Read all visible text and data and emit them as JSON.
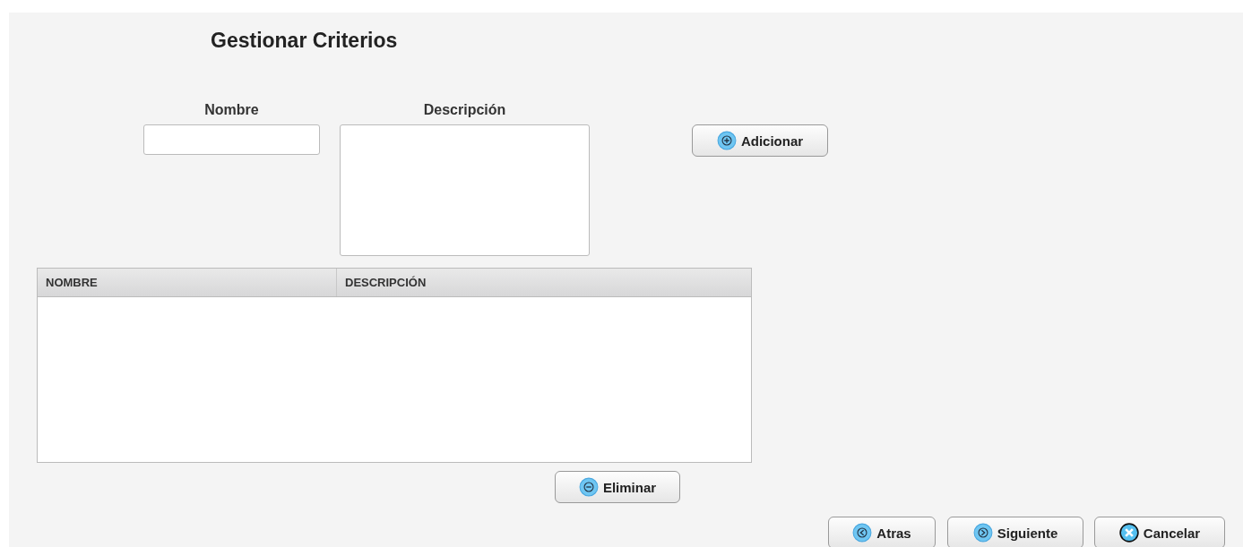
{
  "title": "Gestionar Criterios",
  "form": {
    "fields": [
      {
        "label": "Nombre",
        "kind": "input"
      },
      {
        "label": "Descripción",
        "kind": "textarea"
      }
    ],
    "add_button": {
      "label": "Adicionar",
      "kind": "add"
    }
  },
  "table": {
    "columns": [
      "NOMBRE",
      "DESCRIPCIÓN"
    ]
  },
  "delete_button": {
    "label": "Eliminar",
    "kind": "remove"
  },
  "nav_buttons": [
    {
      "label": "Atras",
      "kind": "back"
    },
    {
      "label": "Siguiente",
      "kind": "next"
    },
    {
      "label": "Cancelar",
      "kind": "cancel"
    }
  ]
}
